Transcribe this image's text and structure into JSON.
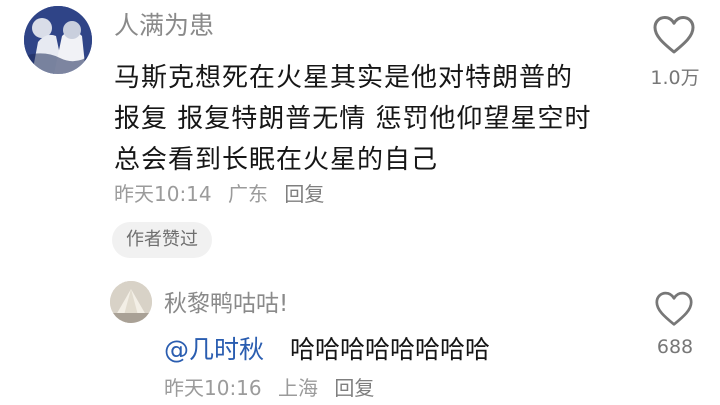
{
  "comment": {
    "username": "人满为患",
    "lines": [
      "马斯克想死在火星其实是他对特朗普的",
      "报复 报复特朗普无情 惩罚他仰望星空时",
      "总会看到长眠在火星的自己"
    ],
    "time": "昨天10:14",
    "location": "广东",
    "reply_label": "回复",
    "like_count": "1.0万",
    "author_badge": "作者赞过",
    "like_icon": "heart-outline-icon"
  },
  "reply": {
    "username": "秋黎鸭咕咕!",
    "mention": "@几时秋",
    "text": "哈哈哈哈哈哈哈哈",
    "time": "昨天10:16",
    "location": "上海",
    "reply_label": "回复",
    "like_count": "688",
    "like_icon": "heart-outline-icon"
  },
  "colors": {
    "mention": "#2a5db0",
    "meta": "#9b9b9b",
    "username": "#8a8a8a"
  }
}
